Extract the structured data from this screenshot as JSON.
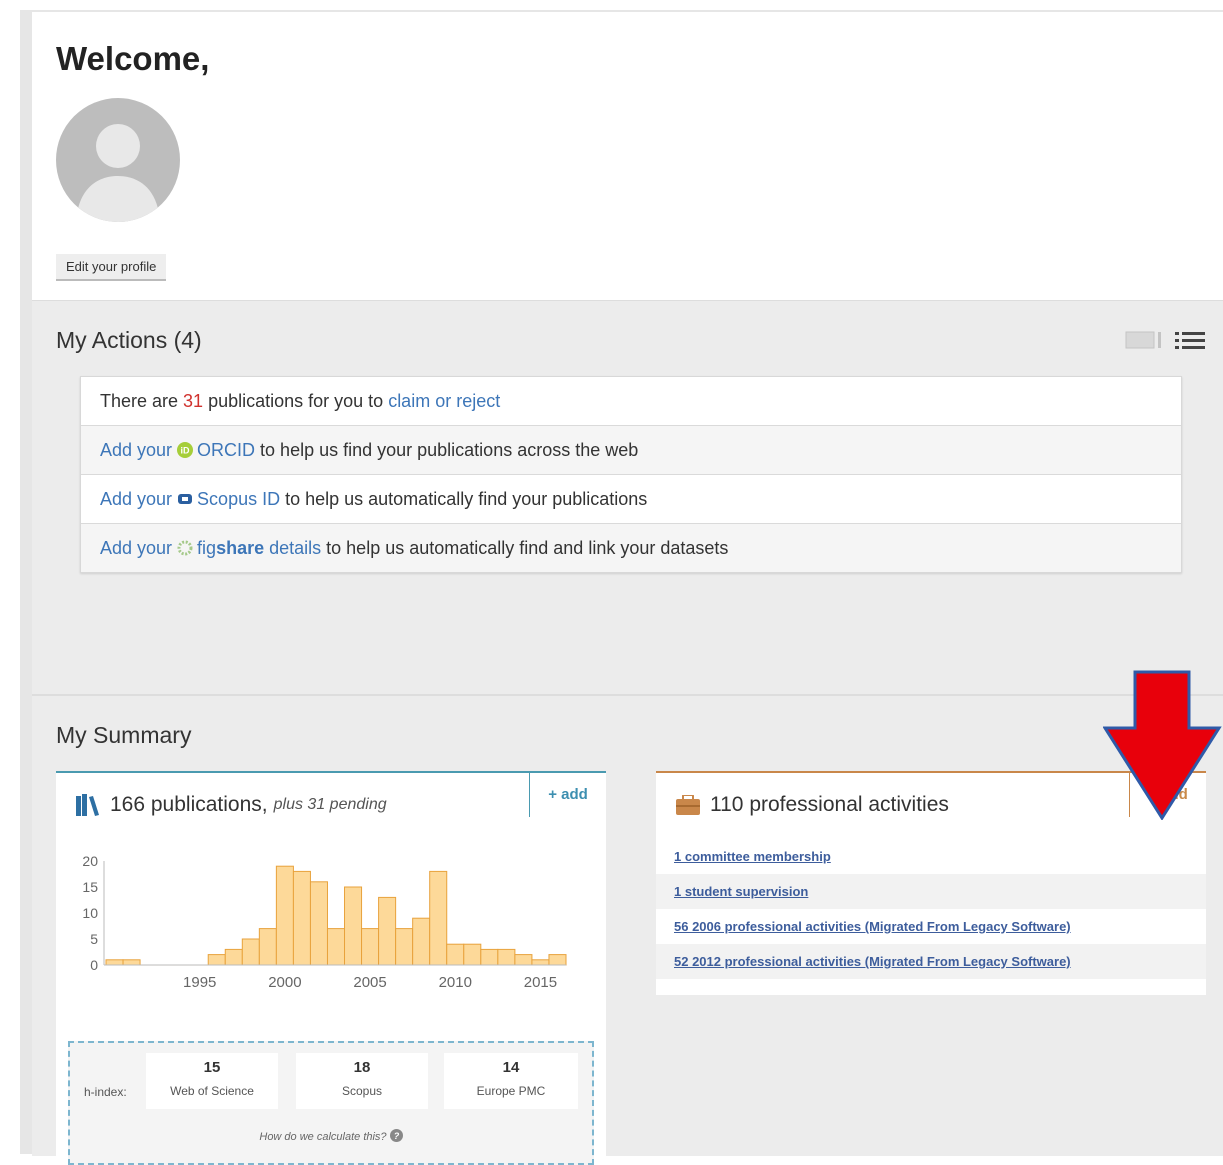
{
  "welcome": {
    "title": "Welcome,",
    "edit_profile": "Edit your profile"
  },
  "actions": {
    "title": "My Actions (4)",
    "rows": [
      {
        "prefix": "There are ",
        "count": "31",
        "middle": " publications for you to ",
        "link": "claim or reject",
        "suffix": ""
      },
      {
        "prefix": "Add your ",
        "link": "ORCID",
        "suffix": " to help us find your publications across the web",
        "icon": "orcid-icon"
      },
      {
        "prefix": "Add your ",
        "link": "Scopus ID",
        "suffix": " to help us automatically find your publications",
        "icon": "scopus-icon"
      },
      {
        "prefix": "Add your ",
        "link_pre": "fig",
        "link_bold": "share",
        "link": " details",
        "suffix": " to help us automatically find and link your datasets",
        "icon": "figshare-icon"
      }
    ]
  },
  "summary": {
    "title": "My Summary",
    "publications": {
      "count_label": "166 publications,",
      "pending": "plus 31 pending",
      "add": "+ add"
    },
    "hindex": {
      "label": "h-index:",
      "sources": [
        {
          "value": "15",
          "name": "Web of Science"
        },
        {
          "value": "18",
          "name": "Scopus"
        },
        {
          "value": "14",
          "name": "Europe PMC"
        }
      ],
      "calc_link": "How do we calculate this?"
    },
    "activities": {
      "title": "110 professional activities",
      "add": "+ add",
      "items": [
        "1 committee membership",
        "1 student supervision",
        "56 2006 professional activities (Migrated From Legacy Software)",
        "52 2012 professional activities (Migrated From Legacy Software)"
      ]
    }
  },
  "colors": {
    "link": "#3d76b8",
    "accent_pub": "#4a9ab0",
    "accent_act": "#c9874a",
    "bar_fill": "#fdd999",
    "bar_stroke": "#e8a23c",
    "arrow": "#e8000b"
  },
  "chart_data": {
    "type": "bar",
    "x": [
      1990,
      1991,
      1992,
      1993,
      1994,
      1995,
      1996,
      1997,
      1998,
      1999,
      2000,
      2001,
      2002,
      2003,
      2004,
      2005,
      2006,
      2007,
      2008,
      2009,
      2010,
      2011,
      2012,
      2013,
      2014,
      2015,
      2016
    ],
    "values": [
      1,
      1,
      0,
      0,
      0,
      0,
      2,
      3,
      5,
      7,
      19,
      18,
      16,
      7,
      15,
      7,
      13,
      7,
      9,
      18,
      4,
      4,
      3,
      3,
      2,
      1,
      2
    ],
    "xticks": [
      "1995",
      "2000",
      "2005",
      "2010",
      "2015"
    ],
    "yticks": [
      "0",
      "5",
      "10",
      "15",
      "20"
    ],
    "ylim": [
      0,
      20
    ]
  }
}
